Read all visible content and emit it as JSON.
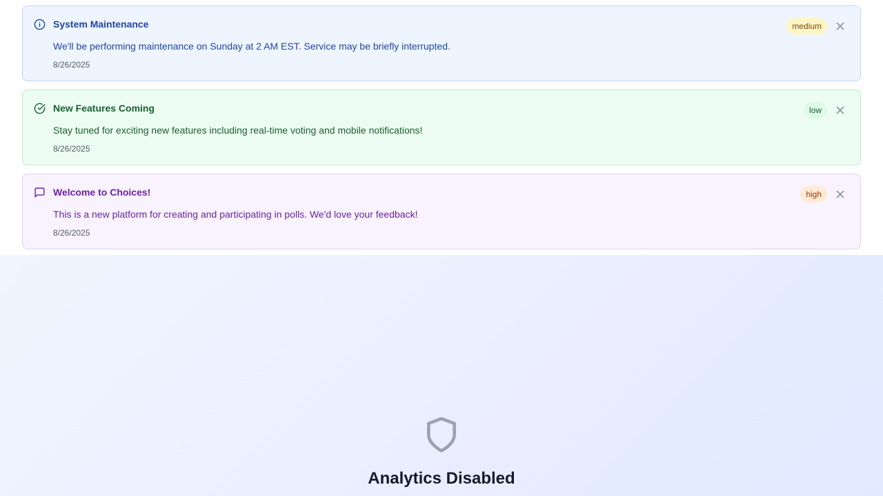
{
  "announcements": [
    {
      "title": "System Maintenance",
      "message": "We'll be performing maintenance on Sunday at 2 AM EST. Service may be briefly interrupted.",
      "date": "8/26/2025",
      "priority": "medium",
      "icon": "info-icon",
      "color": "#1f45a8"
    },
    {
      "title": "New Features Coming",
      "message": "Stay tuned for exciting new features including real-time voting and mobile notifications!",
      "date": "8/26/2025",
      "priority": "low",
      "icon": "check-circle-icon",
      "color": "#17602f"
    },
    {
      "title": "Welcome to Choices!",
      "message": "This is a new platform for creating and participating in polls. We'd love your feedback!",
      "date": "8/26/2025",
      "priority": "high",
      "icon": "message-square-icon",
      "color": "#6b22a6"
    }
  ],
  "analytics": {
    "title": "Analytics Disabled",
    "icon": "shield-icon"
  }
}
